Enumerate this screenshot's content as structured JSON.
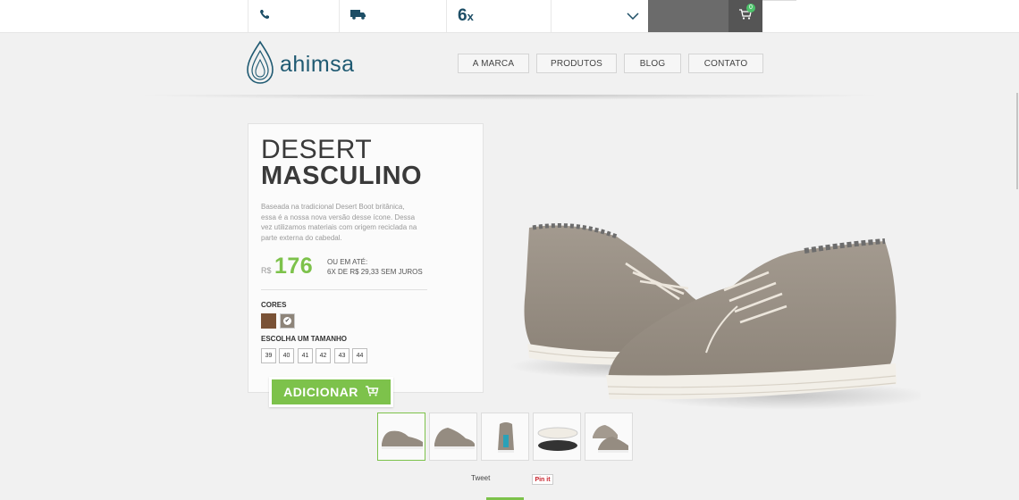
{
  "topbar": {
    "installments_number": "6",
    "installments_suffix": "x",
    "cart_count": "0"
  },
  "brand": {
    "name": "ahimsa"
  },
  "nav": [
    {
      "label": "A MARCA"
    },
    {
      "label": "PRODUTOS"
    },
    {
      "label": "BLOG"
    },
    {
      "label": "CONTATO"
    }
  ],
  "product": {
    "title_line1": "DESERT",
    "title_line2": "MASCULINO",
    "description": "Baseada na tradicional Desert Boot britânica, essa é a nossa nova versão desse ícone. Dessa vez utilizamos materiais com origem reciclada na parte externa do cabedal.",
    "currency": "R$",
    "price": "176",
    "installments_label": "OU EM ATÉ:",
    "installments_detail": "6X DE R$ 29,33 SEM JUROS",
    "colors_label": "CORES",
    "colors": [
      "#7a5236",
      "#8d8479"
    ],
    "selected_color_mark": "✔",
    "size_label": "ESCOLHA UM TAMANHO",
    "sizes": [
      "39",
      "40",
      "41",
      "42",
      "43",
      "44"
    ],
    "add_button": "ADICIONAR"
  },
  "social": {
    "tweet": "Tweet",
    "pinit": "Pin it"
  },
  "colors": {
    "accent": "#7dc24b",
    "brand": "#1f5a72"
  }
}
